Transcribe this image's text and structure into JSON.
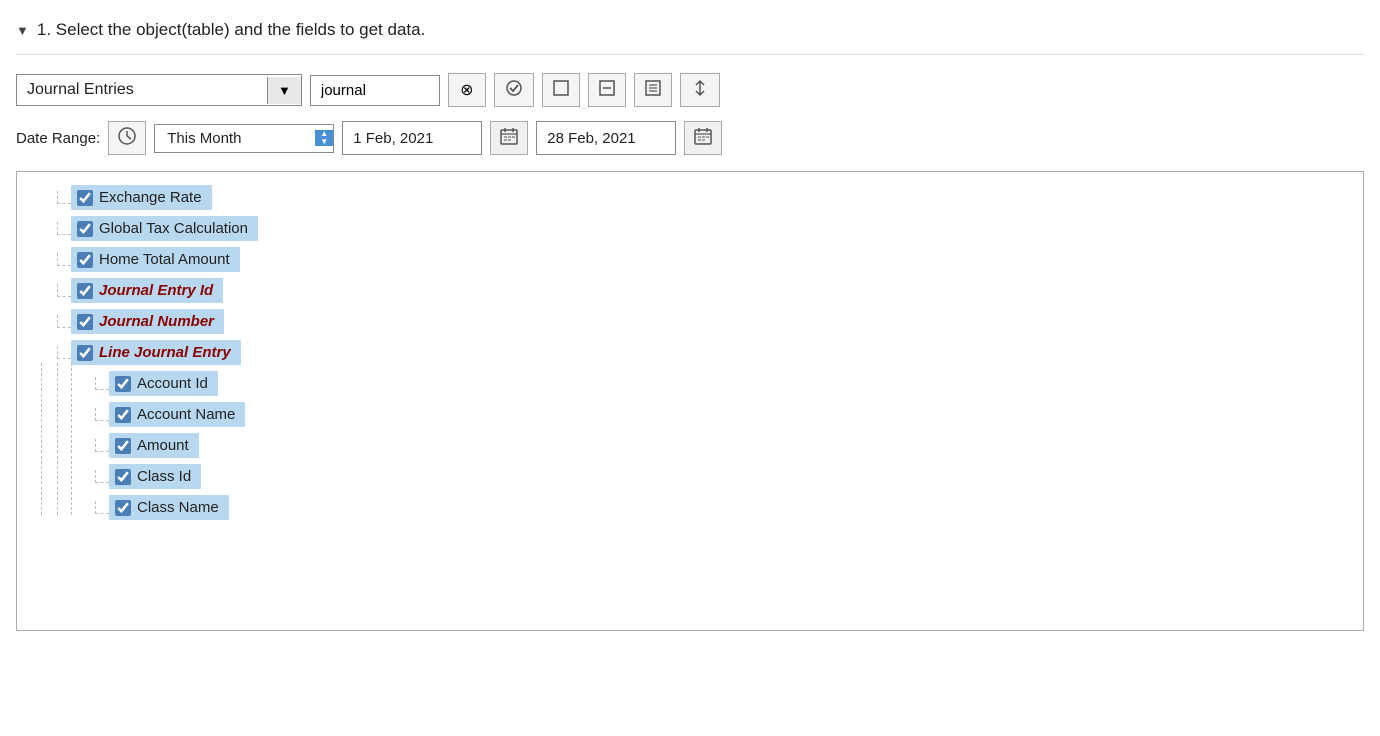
{
  "section": {
    "title": "1. Select the object(table) and the fields to get data.",
    "collapse_icon": "▼"
  },
  "toolbar": {
    "object_value": "Journal Entries",
    "dropdown_arrow": "▼",
    "search_value": "journal",
    "btn_clear": "⊗",
    "btn_check": "✔",
    "btn_square1": "□",
    "btn_square2": "◻",
    "btn_square3": "◻",
    "btn_sort": "⇅"
  },
  "date_range": {
    "label": "Date Range:",
    "clock": "🕐",
    "preset": "This Month",
    "start_date": "1 Feb, 2021",
    "end_date": "28 Feb, 2021",
    "calendar_icon": "▦"
  },
  "fields": [
    {
      "id": "exchange-rate",
      "label": "Exchange Rate",
      "checked": true,
      "indent": "1",
      "bold_red": false,
      "has_connector": false
    },
    {
      "id": "global-tax",
      "label": "Global Tax Calculation",
      "checked": true,
      "indent": "1",
      "bold_red": false,
      "has_connector": false
    },
    {
      "id": "home-total",
      "label": "Home Total Amount",
      "checked": true,
      "indent": "1",
      "bold_red": false,
      "has_connector": false
    },
    {
      "id": "journal-entry-id",
      "label": "Journal Entry Id",
      "checked": true,
      "indent": "1",
      "bold_red": true,
      "has_connector": false
    },
    {
      "id": "journal-number",
      "label": "Journal Number",
      "checked": true,
      "indent": "1",
      "bold_red": true,
      "has_connector": false
    },
    {
      "id": "line-journal-entry",
      "label": "Line Journal Entry",
      "checked": true,
      "indent": "1",
      "bold_red": true,
      "has_connector": false,
      "has_expand": true
    },
    {
      "id": "account-id",
      "label": "Account Id",
      "checked": true,
      "indent": "2",
      "bold_red": false,
      "has_connector": true
    },
    {
      "id": "account-name",
      "label": "Account Name",
      "checked": true,
      "indent": "2",
      "bold_red": false,
      "has_connector": true
    },
    {
      "id": "amount",
      "label": "Amount",
      "checked": true,
      "indent": "2",
      "bold_red": false,
      "has_connector": true
    },
    {
      "id": "class-id",
      "label": "Class Id",
      "checked": true,
      "indent": "2",
      "bold_red": false,
      "has_connector": true
    },
    {
      "id": "class-name",
      "label": "Class Name",
      "checked": true,
      "indent": "2",
      "bold_red": false,
      "has_connector": true
    }
  ]
}
